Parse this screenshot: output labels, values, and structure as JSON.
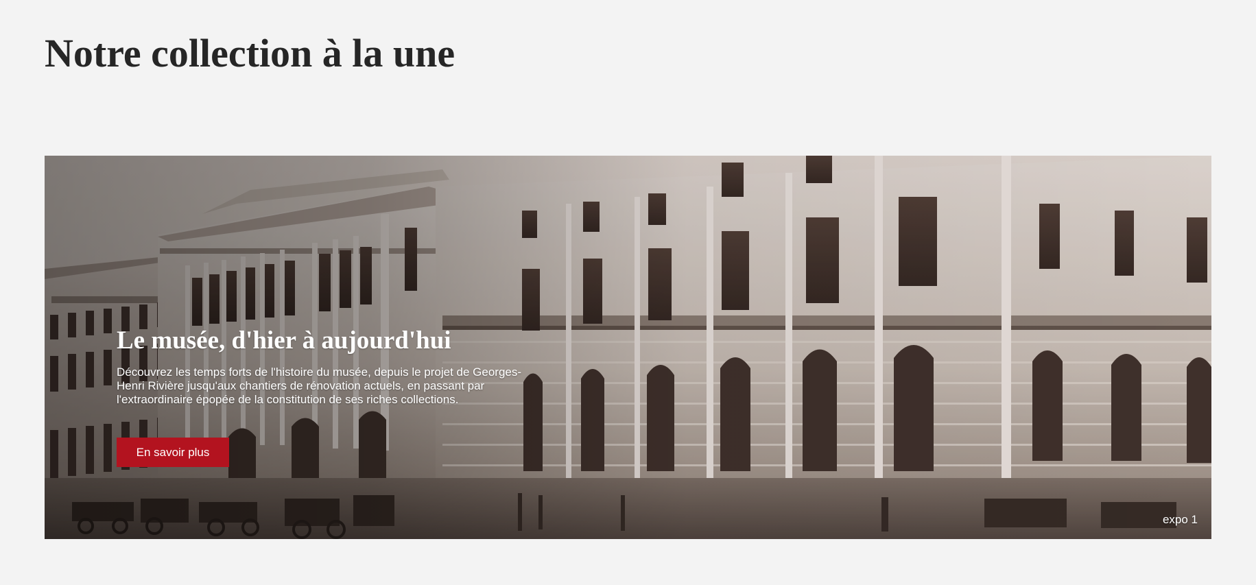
{
  "page": {
    "title": "Notre collection à la une"
  },
  "featured": {
    "title": "Le musée, d'hier à aujourd'hui",
    "description": "Découvrez les temps forts de l'histoire du musée, depuis le projet de Georges-Henri Rivière jusqu'aux chantiers de rénovation actuels, en passant par l'extraordinaire épopée de la constitution de ses riches collections.",
    "button_label": "En savoir plus",
    "slide_label": "expo 1",
    "image_alt": "Historic sepia photograph of the museum building facade"
  },
  "colors": {
    "background": "#f3f3f3",
    "accent": "#b3131f",
    "title": "#262626",
    "hero_text": "#ffffff"
  }
}
